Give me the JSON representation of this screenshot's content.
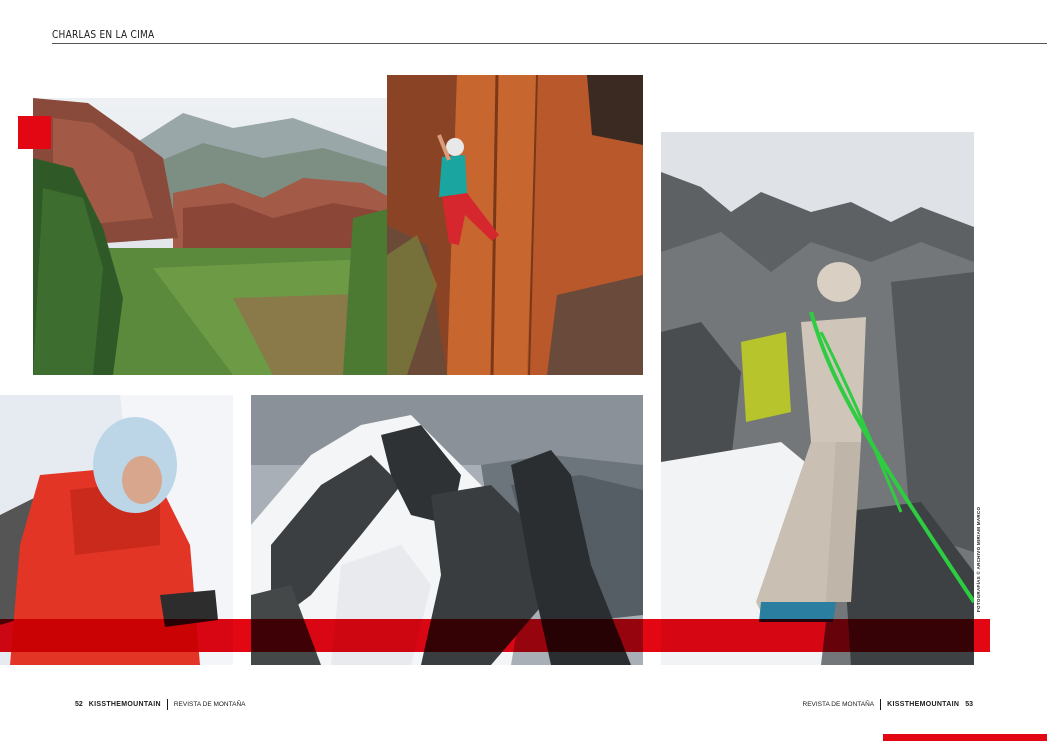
{
  "header": {
    "section_title": "CHARLAS EN LA CIMA"
  },
  "footer_left": {
    "page_number": "52",
    "brand": "KISSTHEMOUNTAIN",
    "magazine": "REVISTA DE MONTAÑA"
  },
  "footer_right": {
    "magazine": "REVISTA DE MONTAÑA",
    "brand": "KISSTHEMOUNTAIN",
    "page_number": "53"
  },
  "photo_credit": "FOTOGRAFÍAS © ARCHIVO MIRIAM MARCO",
  "colors": {
    "accent_red": "#e30613",
    "text": "#1a1a1a"
  }
}
